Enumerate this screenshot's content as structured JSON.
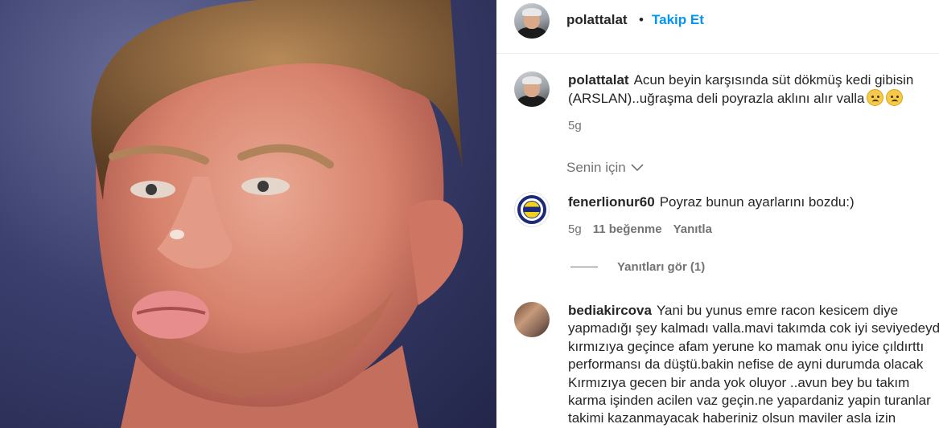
{
  "post": {
    "author": "polattalat",
    "separator": "•",
    "follow_label": "Takip Et"
  },
  "caption": {
    "author": "polattalat",
    "text_line1": "Acun beyin karşısında süt dökmüş kedi gibisin",
    "text_line2": "(ARSLAN)..uğraşma deli poyrazla aklını alır valla",
    "time": "5g"
  },
  "filter": {
    "label": "Senin için"
  },
  "comments": [
    {
      "author": "fenerlionur60",
      "text": "Poyraz bunun ayarlarını bozdu:)",
      "time": "5g",
      "likes": "11 beğenme",
      "reply_label": "Yanıtla",
      "view_replies": "Yanıtları gör (1)"
    },
    {
      "author": "bediakircova",
      "lines": [
        "Yani bu yunus emre racon kesicem diye",
        "yapmadığı şey kalmadı valla.mavi takımda cok iyi seviyedeydi",
        "kırmızıya geçince afam yerune ko mamak onu iyice çıldırttı",
        "performansı da düştü.bakin nefise de ayni durumda olacak",
        "Kırmızıya gecen bir anda yok oluyor ..avun bey bu takım",
        "karma işinden acilen vaz geçin.ne yapardaniz yapin turanlar",
        "takimi kazanmayacak haberiniz olsun maviler asla izin"
      ]
    }
  ],
  "colors": {
    "link": "#0095f6",
    "text": "#262626",
    "muted": "#737373"
  }
}
